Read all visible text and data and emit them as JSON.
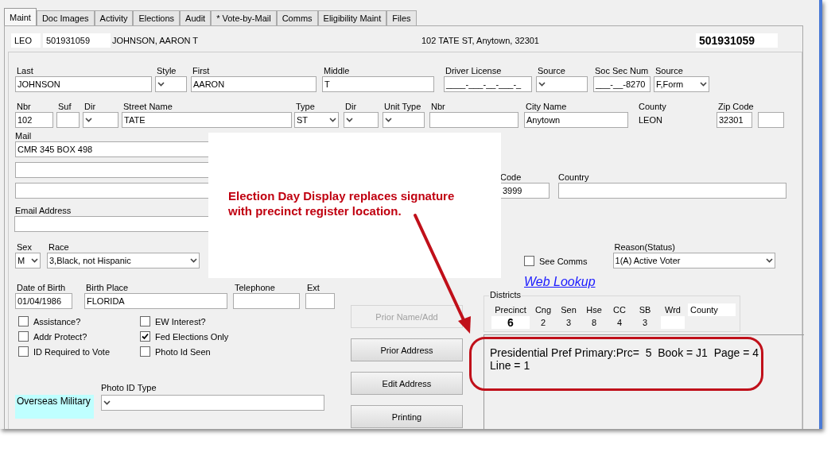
{
  "tabs": [
    {
      "label": "Maint",
      "selected": true
    },
    {
      "label": "Doc Images",
      "selected": false
    },
    {
      "label": "Activity",
      "selected": false
    },
    {
      "label": "Elections",
      "selected": false
    },
    {
      "label": "Audit",
      "selected": false
    },
    {
      "label": "* Vote-by-Mail",
      "selected": false
    },
    {
      "label": "Comms",
      "selected": false
    },
    {
      "label": "Eligibility Maint",
      "selected": false
    },
    {
      "label": "Files",
      "selected": false
    }
  ],
  "header": {
    "county_code": "LEO",
    "voter_id": "501931059",
    "name": "JOHNSON, AARON T",
    "address": "102 TATE ST, Anytown, 32301",
    "voter_id_large": "501931059"
  },
  "name_row": [
    {
      "kind": "text",
      "label": "Last",
      "value": "JOHNSON"
    },
    {
      "kind": "select",
      "label": "Style"
    },
    {
      "kind": "text",
      "label": "First",
      "value": "AARON"
    },
    {
      "kind": "text",
      "label": "Middle",
      "value": "T"
    },
    {
      "kind": "text",
      "label": "Driver License",
      "value": "____-___-__-___-_"
    },
    {
      "kind": "select",
      "label": "Source"
    },
    {
      "kind": "text",
      "label": "Soc Sec Num",
      "value": "___-__-8270"
    },
    {
      "kind": "select",
      "label": "Source",
      "value": "F,Form"
    }
  ],
  "address_row": [
    {
      "kind": "text",
      "label": "Nbr",
      "value": "102"
    },
    {
      "kind": "text",
      "label": "Suf"
    },
    {
      "kind": "select",
      "label": "Dir"
    },
    {
      "kind": "text",
      "label": "Street Name",
      "value": "TATE"
    },
    {
      "kind": "select",
      "label": "Type",
      "value": "ST"
    },
    {
      "kind": "select",
      "label": "Dir"
    },
    {
      "kind": "select",
      "label": "Unit Type"
    },
    {
      "kind": "text",
      "label": "Nbr"
    },
    {
      "kind": "text",
      "label": "City Name",
      "value": "Anytown"
    },
    {
      "kind": "static",
      "label": "County",
      "value": "LEON"
    },
    {
      "kind": "text",
      "label": "Zip Code",
      "value": "32301"
    },
    {
      "kind": "text"
    }
  ],
  "mail": {
    "label": "Mail",
    "value": "CMR 345 BOX 498"
  },
  "mail_zip": {
    "label": "Code",
    "value": "3999"
  },
  "country": {
    "label": "Country"
  },
  "email": {
    "label": "Email Address"
  },
  "sex": {
    "label": "Sex",
    "value": "M"
  },
  "race": {
    "label": "Race",
    "value": "3,Black, not Hispanic"
  },
  "see_comms": {
    "label": "See Comms",
    "checked": false
  },
  "reason": {
    "label": "Reason(Status)",
    "value": "1(A) Active Voter"
  },
  "web_lookup": "Web Lookup",
  "dob_row": [
    {
      "kind": "text",
      "label": "Date of Birth",
      "value": "01/04/1986"
    },
    {
      "kind": "text",
      "label": "Birth Place",
      "value": "FLORIDA"
    },
    {
      "kind": "text",
      "label": "Telephone"
    },
    {
      "kind": "text",
      "label": "Ext"
    }
  ],
  "flags": [
    {
      "label": "Assistance?",
      "checked": false
    },
    {
      "label": "Addr Protect?",
      "checked": false
    },
    {
      "label": "ID Required to Vote",
      "checked": false
    },
    {
      "label": "EW Interest?",
      "checked": false
    },
    {
      "label": "Fed Elections Only",
      "checked": true
    },
    {
      "label": "Photo Id Seen",
      "checked": false
    }
  ],
  "overseas": "Overseas Military",
  "photo_id_type": {
    "label": "Photo ID Type"
  },
  "buttons": [
    {
      "label": "Prior Name/Add",
      "disabled": true
    },
    {
      "label": "Prior Address",
      "disabled": false
    },
    {
      "label": "Edit Address",
      "disabled": false
    },
    {
      "label": "Printing",
      "disabled": false
    }
  ],
  "districts": {
    "title": "Districts",
    "columns": [
      {
        "label": "Precinct",
        "value": "6"
      },
      {
        "label": "Cng",
        "value": "2"
      },
      {
        "label": "Sen",
        "value": "3"
      },
      {
        "label": "Hse",
        "value": "8"
      },
      {
        "label": "CC",
        "value": "4"
      },
      {
        "label": "SB",
        "value": "3"
      },
      {
        "label": "Wrd"
      },
      {
        "label": "County"
      }
    ]
  },
  "register_info": "Presidential Pref Primary:Prc=  5  Book = J1  Page = 4\nLine = 1",
  "annotation": "Election Day Display replaces signature\nwith precinct register location."
}
